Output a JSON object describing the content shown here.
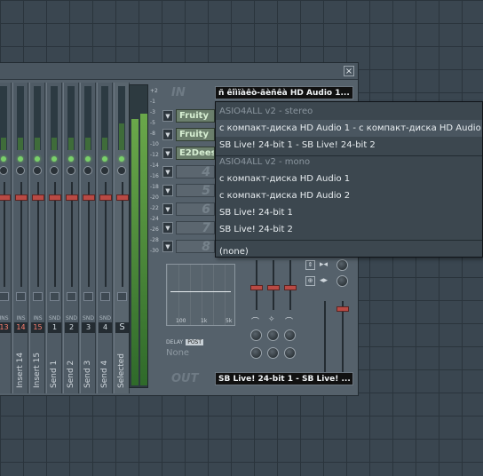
{
  "mixer": {
    "close_glyph": "×",
    "in_label": "IN",
    "out_label": "OUT",
    "input_device": "ñ êîìïàêò-äèñêà HD Audio 1...",
    "output_device": "SB Live! 24-bit 1 - SB Live! ...",
    "db_scale": [
      "+2",
      "-1",
      "-3",
      "-5",
      "-8",
      "-10",
      "-12",
      "-14",
      "-16",
      "-18",
      "-20",
      "-22",
      "-24",
      "-26",
      "-28",
      "-30"
    ],
    "strips": [
      {
        "name": "",
        "tag": "INS",
        "num": "13",
        "kind": "ins"
      },
      {
        "name": "Insert 14",
        "tag": "INS",
        "num": "14",
        "kind": "ins"
      },
      {
        "name": "Insert 15",
        "tag": "INS",
        "num": "15",
        "kind": "ins"
      },
      {
        "name": "Send 1",
        "tag": "SND",
        "num": "1",
        "kind": "snd"
      },
      {
        "name": "Send 2",
        "tag": "SND",
        "num": "2",
        "kind": "snd"
      },
      {
        "name": "Send 3",
        "tag": "SND",
        "num": "3",
        "kind": "snd"
      },
      {
        "name": "Send 4",
        "tag": "SND",
        "num": "4",
        "kind": "snd"
      },
      {
        "name": "Selected",
        "tag": "",
        "num": "S",
        "kind": "sel"
      }
    ],
    "fx_slots": [
      {
        "name": "Fruity",
        "empty": false
      },
      {
        "name": "Fruity",
        "empty": false
      },
      {
        "name": "E2Dees",
        "empty": false
      },
      {
        "name": "4",
        "empty": true
      },
      {
        "name": "5",
        "empty": true
      },
      {
        "name": "6",
        "empty": true
      },
      {
        "name": "7",
        "empty": true
      },
      {
        "name": "8",
        "empty": true
      }
    ],
    "eq_freqs": [
      "100",
      "1k",
      "5k"
    ],
    "delay_label": "DELAY",
    "post_label": "POST",
    "delay_value": "None"
  },
  "dropdown": {
    "items": [
      {
        "label": "ASIO4ALL v2 - stereo",
        "type": "header"
      },
      {
        "label": "с компакт-диска HD Audio 1 - с компакт-диска HD Audio 2",
        "type": "item",
        "highlight": true
      },
      {
        "label": "SB Live! 24-bit 1 - SB Live! 24-bit 2",
        "type": "item"
      },
      {
        "label": "ASIO4ALL v2 - mono",
        "type": "header"
      },
      {
        "label": "с компакт-диска HD Audio 1",
        "type": "item"
      },
      {
        "label": "с компакт-диска HD Audio 2",
        "type": "item"
      },
      {
        "label": "SB Live! 24-bit 1",
        "type": "item"
      },
      {
        "label": "SB Live! 24-bit 2",
        "type": "item"
      },
      {
        "label": "(none)",
        "type": "item"
      }
    ]
  }
}
